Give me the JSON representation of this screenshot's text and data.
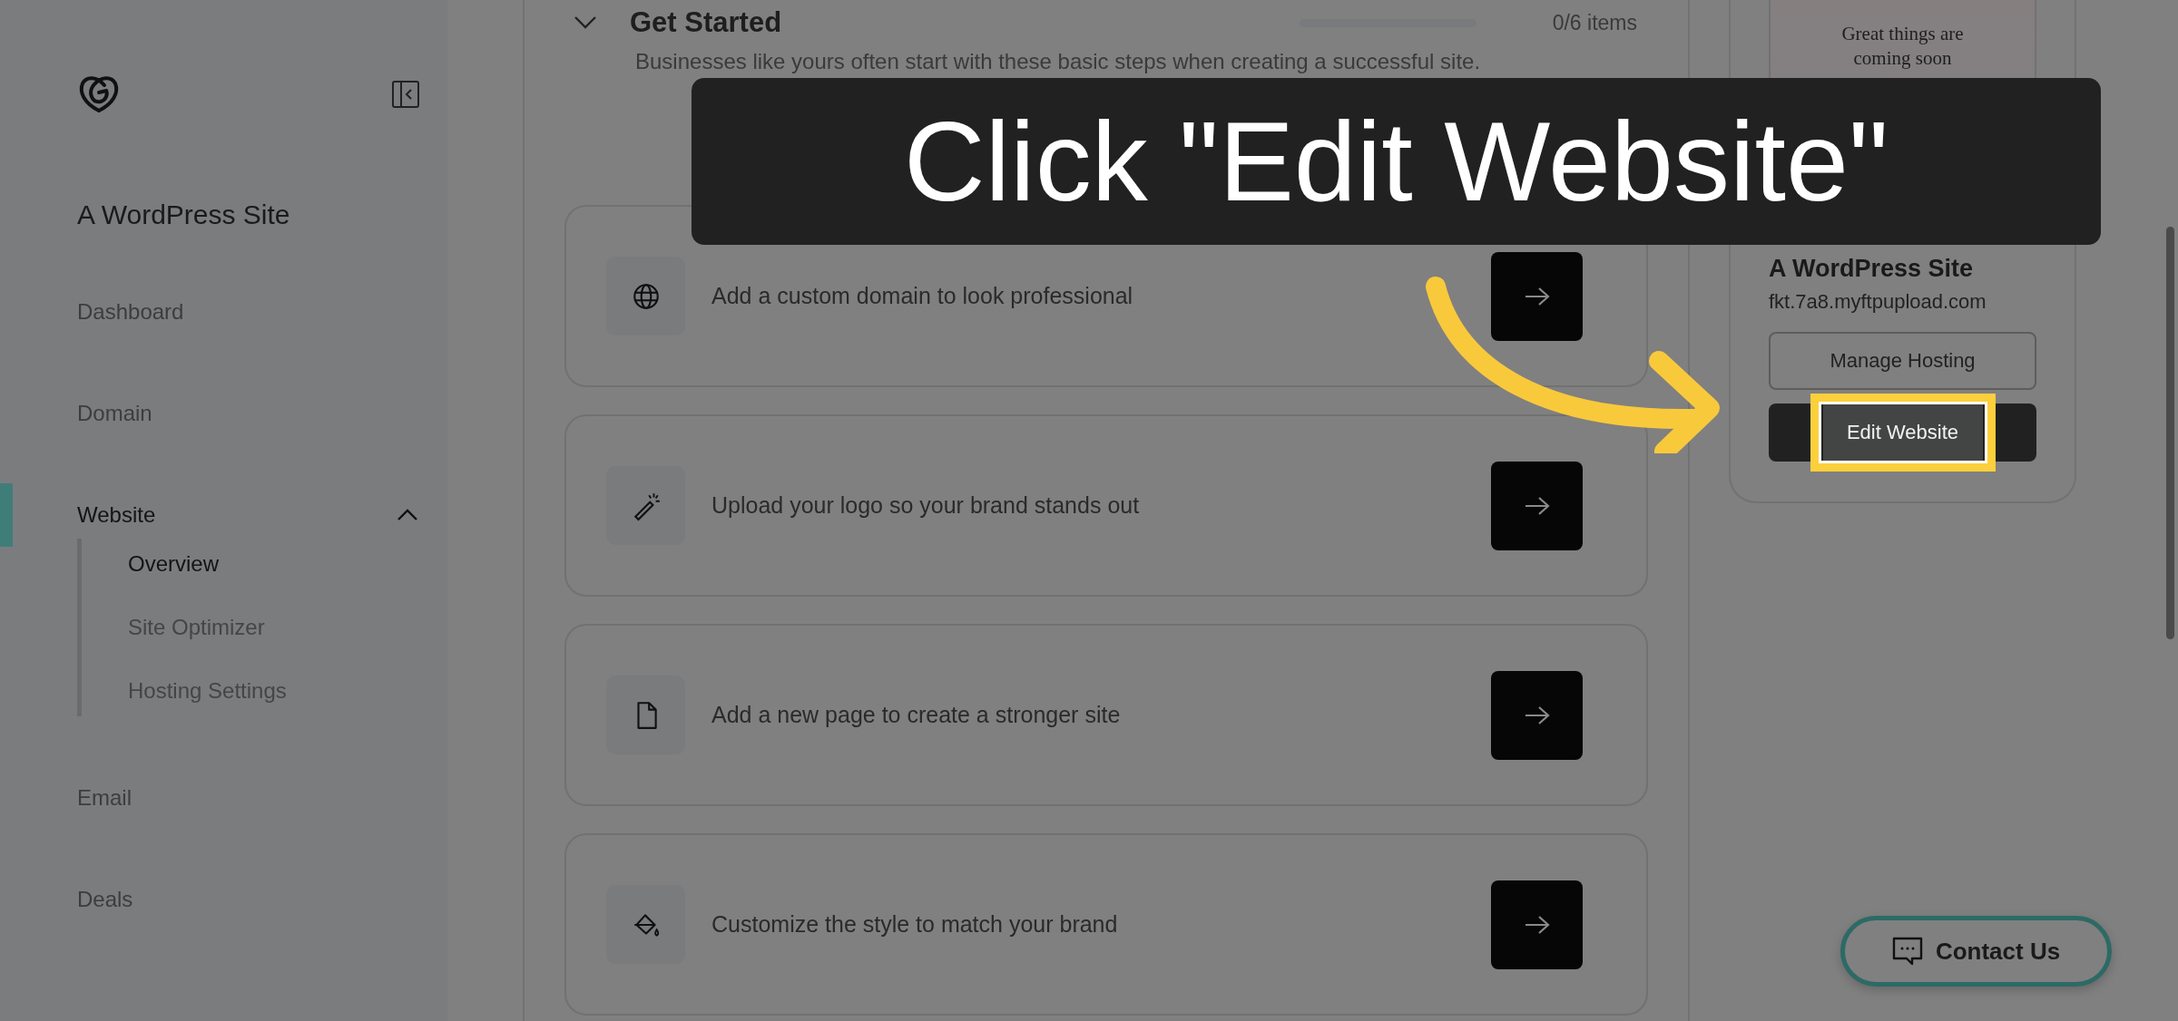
{
  "sidebar": {
    "site_name": "A WordPress Site",
    "items": [
      {
        "label": "Dashboard",
        "selected": false
      },
      {
        "label": "Domain",
        "selected": false
      },
      {
        "label": "Website",
        "selected": true,
        "expanded": true,
        "children": [
          {
            "label": "Overview",
            "selected": true
          },
          {
            "label": "Site Optimizer",
            "selected": false
          },
          {
            "label": "Hosting Settings",
            "selected": false
          }
        ]
      },
      {
        "label": "Email",
        "selected": false
      },
      {
        "label": "Deals",
        "selected": false
      }
    ]
  },
  "get_started": {
    "title": "Get Started",
    "expanded": true,
    "progress": {
      "level": 0,
      "reading": "0/6 items"
    },
    "description": "Businesses like yours often start with these basic steps when creating a successful site.",
    "tasks": [
      {
        "kind": "globe",
        "text": "Add a custom domain to look professional"
      },
      {
        "kind": "wand",
        "text": "Upload your logo so your brand stands out"
      },
      {
        "kind": "page",
        "text": "Add a new page to create a stronger site"
      },
      {
        "kind": "paint",
        "text": "Customize the style to match your brand"
      }
    ]
  },
  "site_card": {
    "preview_text": "Great things are coming soon",
    "title": "A WordPress Site",
    "url": "fkt.7a8.myftpupload.com",
    "buttons": [
      {
        "label": "Manage Hosting",
        "kind": "outline",
        "highlighted": false
      },
      {
        "label": "Edit Website",
        "kind": "primary",
        "highlighted": true
      }
    ]
  },
  "annotation": {
    "text": "Click \"Edit Website\""
  },
  "contact_button": {
    "label": "Contact Us"
  }
}
